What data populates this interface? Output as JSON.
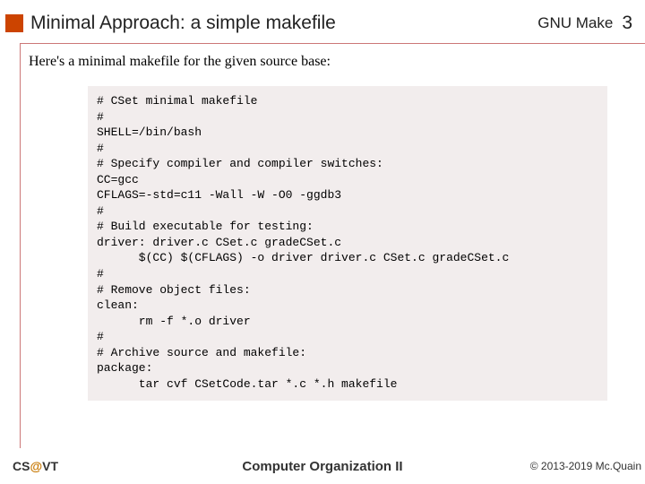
{
  "header": {
    "title": "Minimal Approach: a simple makefile",
    "right_label": "GNU Make",
    "page_number": "3"
  },
  "intro": "Here's a minimal makefile for the given source base:",
  "code": "# CSet minimal makefile\n#\nSHELL=/bin/bash\n#\n# Specify compiler and compiler switches:\nCC=gcc\nCFLAGS=-std=c11 -Wall -W -O0 -ggdb3\n#\n# Build executable for testing:\ndriver: driver.c CSet.c gradeCSet.c\n      $(CC) $(CFLAGS) -o driver driver.c CSet.c gradeCSet.c\n#\n# Remove object files:\nclean:\n      rm -f *.o driver\n#\n# Archive source and makefile:\npackage:\n      tar cvf CSetCode.tar *.c *.h makefile",
  "footer": {
    "left_pre": "CS",
    "left_at": "@",
    "left_post": "VT",
    "center": "Computer Organization II",
    "right": "© 2013-2019 Mc.Quain"
  }
}
